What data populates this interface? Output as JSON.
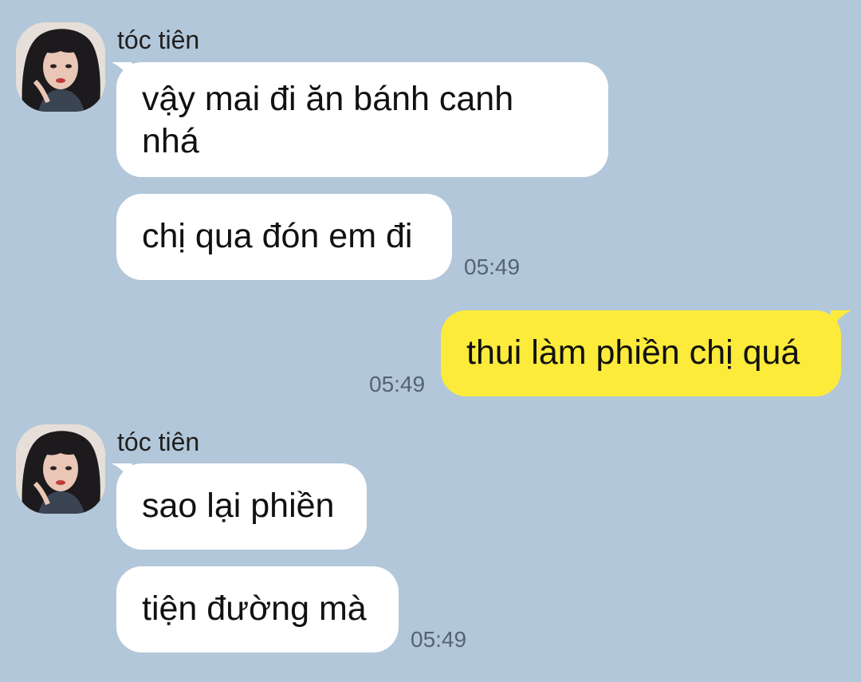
{
  "colors": {
    "background": "#b2c7d9",
    "incoming_bubble": "#ffffff",
    "outgoing_bubble": "#fdeb3b",
    "timestamp": "#546473"
  },
  "messages": {
    "group1": {
      "sender": "tóc tiên",
      "avatar": "avatar-photo",
      "m1_line1": "vậy mai đi ăn bánh canh",
      "m1_line2": "nhá",
      "m2": "chị qua đón em đi",
      "time": "05:49"
    },
    "outgoing": {
      "text": "thui làm phiền chị quá",
      "time": "05:49"
    },
    "group2": {
      "sender": "tóc tiên",
      "avatar": "avatar-photo",
      "m1": "sao lại phiền",
      "m2": "tiện đường mà",
      "time": "05:49"
    }
  }
}
